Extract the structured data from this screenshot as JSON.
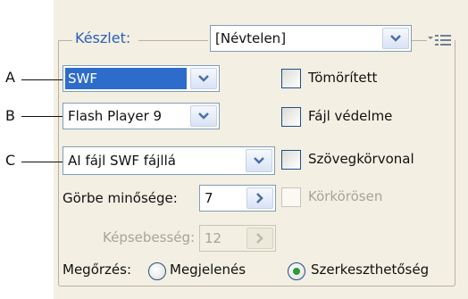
{
  "preset": {
    "label": "Készlet:",
    "value": "[Névtelen]"
  },
  "callouts": {
    "a": "A",
    "b": "B",
    "c": "C"
  },
  "format_select": {
    "value": "SWF"
  },
  "player_select": {
    "value": "Flash Player 9"
  },
  "conversion_select": {
    "value": "AI fájl SWF fájllá"
  },
  "curve_quality": {
    "label": "Görbe minősége:",
    "value": "7"
  },
  "frame_rate": {
    "label": "Képsebesség:",
    "value": "12"
  },
  "checkboxes": {
    "compressed": "Tömörített",
    "protect": "Fájl védelme",
    "outline_text": "Szövegkörvonal",
    "loop": "Körkörösen"
  },
  "preserve": {
    "label": "Megőrzés:",
    "appearance": "Megjelenés",
    "editability": "Szerkeszthetőség",
    "selected": "editability"
  },
  "colors": {
    "accent": "#2d6ccb",
    "legend": "#2a5fb8",
    "panel_bg": "#f3efe2",
    "radio_dot": "#2a9a3a"
  }
}
